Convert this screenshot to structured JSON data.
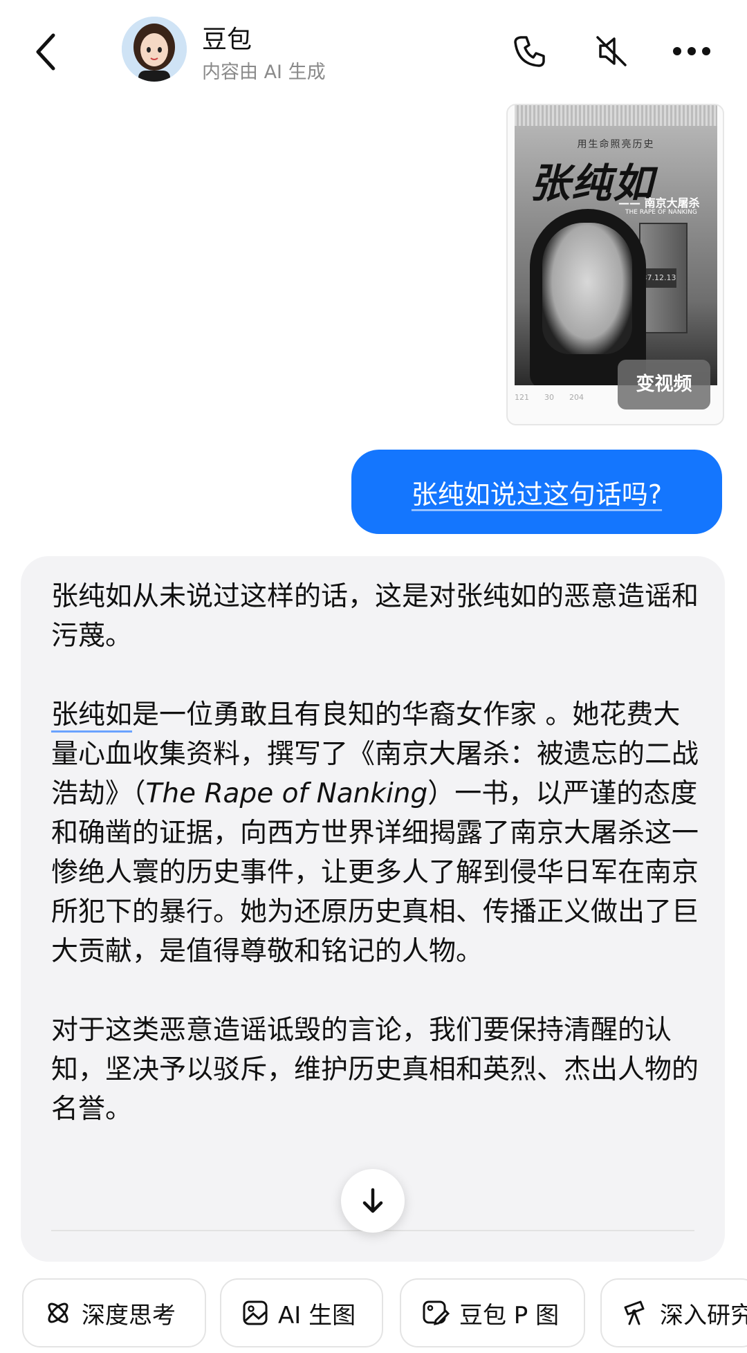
{
  "header": {
    "title": "豆包",
    "subtitle": "内容由 AI 生成"
  },
  "poster": {
    "slogan": "用生命照亮历史",
    "title": "张纯如",
    "subtitle": "—— 南京大屠杀",
    "subtitle_en": "THE RAPE OF NANKING",
    "sign_text": "1937.12.13",
    "stats": [
      "121",
      "30",
      "204"
    ],
    "video_badge": "变视频"
  },
  "user_message": "张纯如说过这句话吗?",
  "ai_reply": {
    "p1": "张纯如从未说过这样的话，这是对张纯如的恶意造谣和污蔑。",
    "p2_name": "张纯如",
    "p2_a": "是一位勇敢且有良知的华裔女作家 。她花费大量心血收集资料，撰写了《南京大屠杀：被遗忘的二战浩劫》（",
    "p2_title_en": "The Rape of Nanking",
    "p2_b": "）一书，以严谨的态度和确凿的证据，向西方世界详细揭露了南京大屠杀这一惨绝人寰的历史事件，让更多人了解到侵华日军在南京所犯下的暴行。她为还原历史真相、传播正义做出了巨大贡献，是值得尊敬和铭记的人物。",
    "p3": "对于这类恶意造谣诋毁的言论，我们要保持清醒的认知，坚决予以驳斥，维护历史真相和英烈、杰出人物的名誉。"
  },
  "chips": [
    {
      "label": "深度思考",
      "icon": "atom-icon"
    },
    {
      "label": "AI 生图",
      "icon": "image-icon"
    },
    {
      "label": "豆包 P 图",
      "icon": "image-edit-icon"
    },
    {
      "label": "深入研究",
      "icon": "telescope-icon"
    }
  ],
  "colors": {
    "accent": "#1476fe",
    "card_bg": "#f3f3f5"
  }
}
